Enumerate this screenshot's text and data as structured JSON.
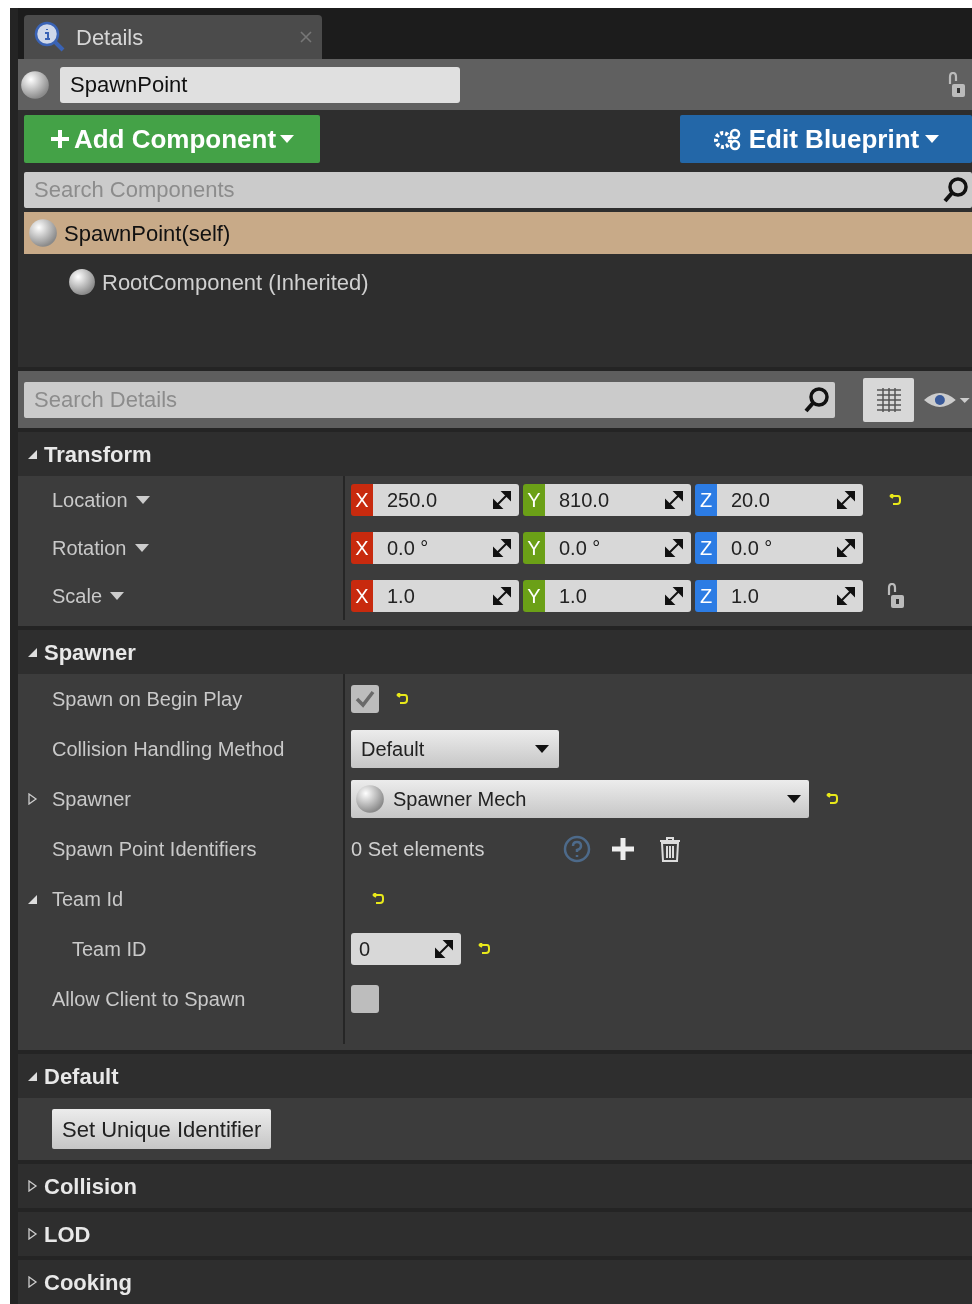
{
  "tab": {
    "label": "Details"
  },
  "actor": {
    "name": "SpawnPoint"
  },
  "add_component": {
    "label": "Add Component"
  },
  "edit_blueprint": {
    "label": "Edit Blueprint"
  },
  "component_search": {
    "placeholder": "Search Components"
  },
  "components": [
    {
      "label": "SpawnPoint(self)",
      "selected": true,
      "children": [
        {
          "label": "RootComponent (Inherited)",
          "selected": false
        }
      ]
    }
  ],
  "details_search": {
    "placeholder": "Search Details"
  },
  "sections": [
    {
      "title": "Transform",
      "expanded": true,
      "rows": [
        {
          "kind": "vector",
          "label": "Location",
          "reset": true,
          "fields": [
            {
              "axis": "X",
              "value": "250.0"
            },
            {
              "axis": "Y",
              "value": "810.0"
            },
            {
              "axis": "Z",
              "value": "20.0"
            }
          ]
        },
        {
          "kind": "vector",
          "label": "Rotation",
          "reset": false,
          "fields": [
            {
              "axis": "X",
              "value": "0.0 °"
            },
            {
              "axis": "Y",
              "value": "0.0 °"
            },
            {
              "axis": "Z",
              "value": "0.0 °"
            }
          ]
        },
        {
          "kind": "vector",
          "label": "Scale",
          "reset": false,
          "locked": false,
          "fields": [
            {
              "axis": "X",
              "value": "1.0"
            },
            {
              "axis": "Y",
              "value": "1.0"
            },
            {
              "axis": "Z",
              "value": "1.0"
            }
          ]
        }
      ]
    },
    {
      "title": "Spawner",
      "expanded": true,
      "rows": [
        {
          "kind": "checkbox",
          "label": "Spawn on Begin Play",
          "checked": true,
          "reset": true
        },
        {
          "kind": "dropdown",
          "label": "Collision Handling Method",
          "value": "Default",
          "reset": false
        },
        {
          "kind": "asset",
          "label": "Spawner",
          "value": "Spawner Mech",
          "expanded": false,
          "reset": true
        },
        {
          "kind": "set",
          "label": "Spawn Point Identifiers",
          "value": "0 Set elements"
        },
        {
          "kind": "group",
          "label": "Team Id",
          "expanded": true,
          "reset": true,
          "children": [
            {
              "kind": "number",
              "label": "Team ID",
              "value": "0",
              "reset": true
            }
          ]
        },
        {
          "kind": "checkbox",
          "label": "Allow Client to Spawn",
          "checked": false,
          "reset": false
        }
      ]
    },
    {
      "title": "Default",
      "expanded": true,
      "rows": [
        {
          "kind": "button",
          "label": "Set Unique Identifier"
        }
      ]
    },
    {
      "title": "Collision",
      "expanded": false
    },
    {
      "title": "LOD",
      "expanded": false
    },
    {
      "title": "Cooking",
      "expanded": false
    }
  ]
}
